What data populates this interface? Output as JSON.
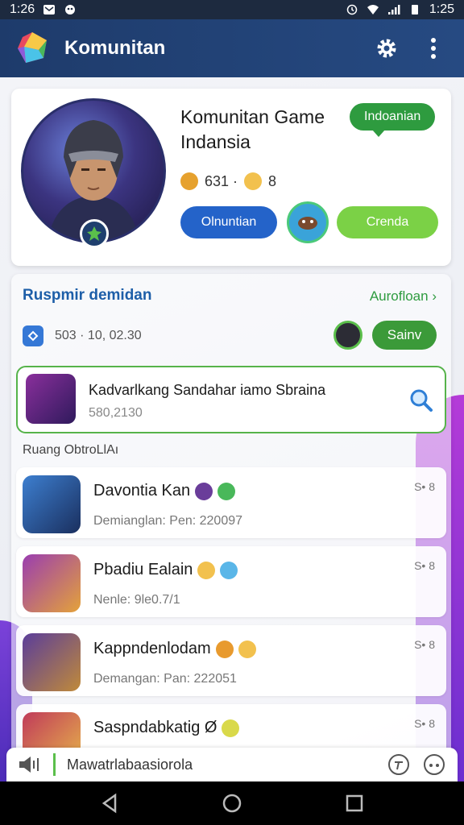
{
  "status_bar": {
    "time_left": "1:26",
    "time_right": "1:25"
  },
  "app_bar": {
    "title": "Komunitan"
  },
  "profile": {
    "title": "Komunitan Game Indansia",
    "tag": "Indoanian",
    "stat": "631 ·",
    "stat2": "8",
    "btn_primary": "Olnuntian",
    "btn_secondary": "Crenda"
  },
  "list": {
    "section_title": "Ruspmir demidan",
    "more": "Aurofloan",
    "search_text": "503 · 10, 02.30",
    "join_button": "Sainv",
    "highlight": {
      "title": "Kadvarlkang Sandahar iamo Sbraina",
      "subtitle": "580,2130"
    },
    "chat_section_label": "Ruang ObtroLlAı",
    "chats": [
      {
        "name": "Davontia Kan",
        "subtitle": "Demianglan: Pen: 220097",
        "meta": "S• 8"
      },
      {
        "name": "Pbadiu Ealain",
        "subtitle": "Nenle: 9le0.7/1",
        "meta": "S• 8"
      },
      {
        "name": "Kappndenlodam",
        "subtitle": "Demangan: Pan: 222051",
        "meta": "S• 8"
      },
      {
        "name": "Saspndabkatig Ø",
        "subtitle": "",
        "meta": "S• 8"
      }
    ]
  },
  "input_bar": {
    "placeholder": "Mawatrlabaasiorola"
  }
}
